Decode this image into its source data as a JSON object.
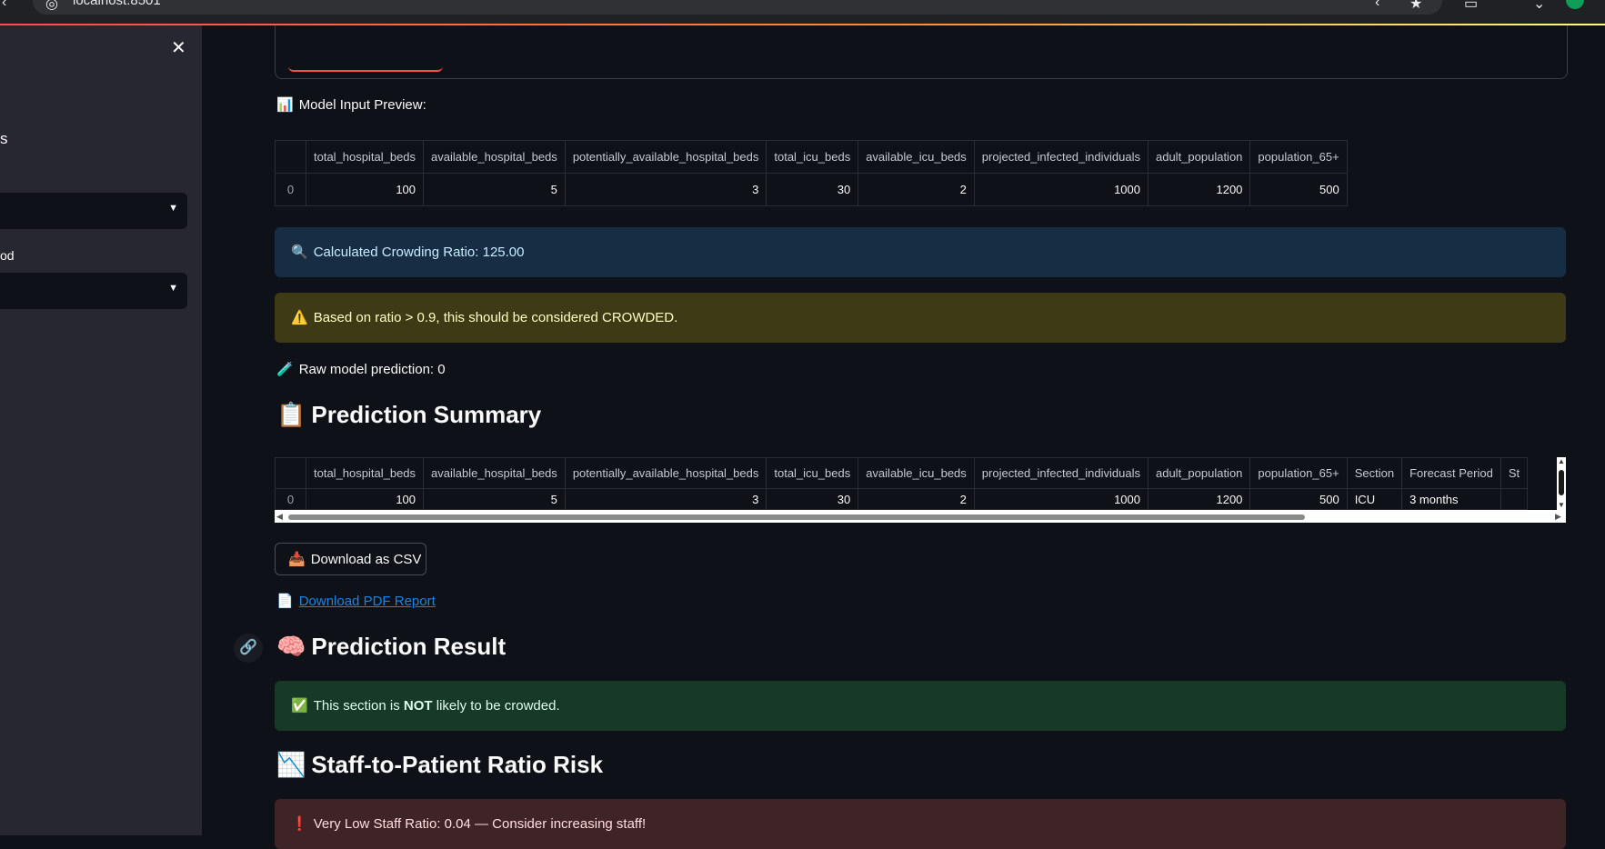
{
  "browser": {
    "url": "localhost:8501"
  },
  "sidebar": {
    "close_icon": "close-icon",
    "fragment_s": "s",
    "fragment_label": "od"
  },
  "main": {
    "model_input_preview_label": "Model Input Preview:",
    "model_input_preview_icon": "bar-chart-icon",
    "input_table": {
      "columns": [
        "",
        "total_hospital_beds",
        "available_hospital_beds",
        "potentially_available_hospital_beds",
        "total_icu_beds",
        "available_icu_beds",
        "projected_infected_individuals",
        "adult_population",
        "population_65+"
      ],
      "rows": [
        [
          "0",
          "100",
          "5",
          "3",
          "30",
          "2",
          "1000",
          "1200",
          "500"
        ]
      ]
    },
    "crowding_ratio_text": "Calculated Crowding Ratio: 125.00",
    "crowded_warning_text": "Based on ratio > 0.9, this should be considered CROWDED.",
    "raw_prediction_text": "Raw model prediction: 0",
    "prediction_summary_heading": "Prediction Summary",
    "summary_table": {
      "columns": [
        "",
        "total_hospital_beds",
        "available_hospital_beds",
        "potentially_available_hospital_beds",
        "total_icu_beds",
        "available_icu_beds",
        "projected_infected_individuals",
        "adult_population",
        "population_65+",
        "Section",
        "Forecast Period",
        "St"
      ],
      "rows": [
        [
          "0",
          "100",
          "5",
          "3",
          "30",
          "2",
          "1000",
          "1200",
          "500",
          "ICU",
          "3 months",
          ""
        ]
      ]
    },
    "download_csv_label": "Download as CSV",
    "download_pdf_label": "Download PDF Report",
    "prediction_result_heading": "Prediction Result",
    "not_crowded_prefix": "This section is ",
    "not_crowded_bold": "NOT",
    "not_crowded_suffix": " likely to be crowded.",
    "staff_ratio_heading": "Staff-to-Patient Ratio Risk",
    "staff_ratio_error": "Very Low Staff Ratio: 0.04 — Consider increasing staff!"
  },
  "colors": {
    "background": "#0e1117",
    "sidebar": "#262730",
    "info": "#172d43",
    "warning": "#3e3a16",
    "success": "#173928",
    "error": "#3e2327",
    "link": "#1c83e1"
  }
}
